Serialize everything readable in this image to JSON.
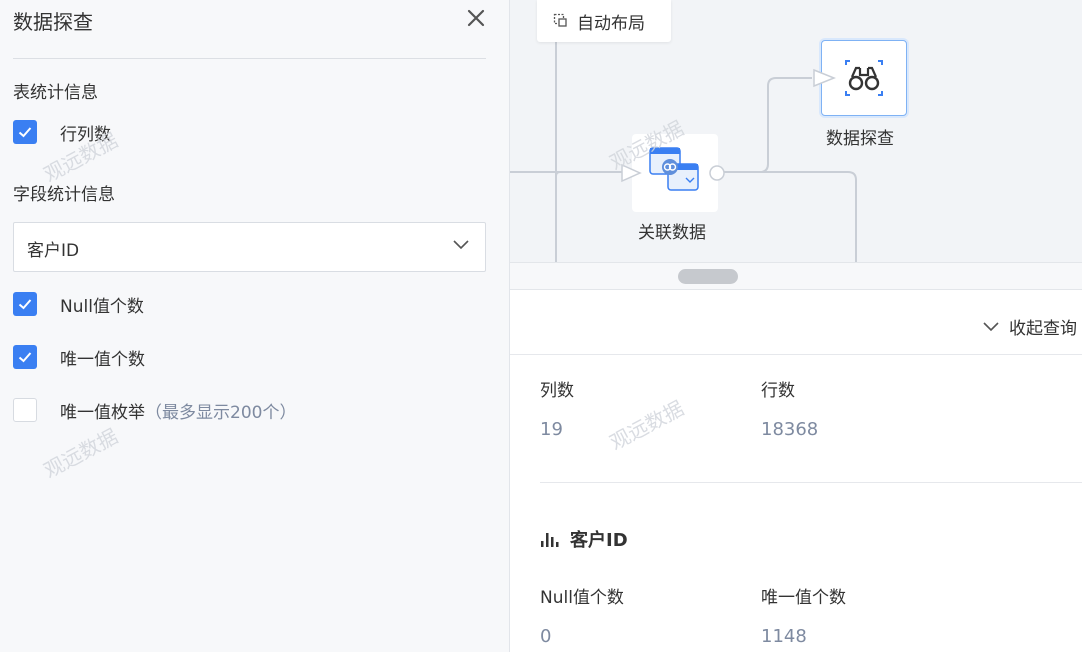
{
  "panel": {
    "title": "数据探查",
    "table_stats_label": "表统计信息",
    "row_col_label": "行列数",
    "field_stats_label": "字段统计信息",
    "field_select_value": "客户ID",
    "null_count_label": "Null值个数",
    "unique_count_label": "唯一值个数",
    "unique_enum_label": "唯一值枚举",
    "unique_enum_hint": "（最多显示200个）",
    "checkboxes": {
      "row_col": true,
      "null_count": true,
      "unique_count": true,
      "unique_enum": false
    }
  },
  "watermark": "观远数据",
  "canvas": {
    "auto_layout_label": "自动布局",
    "join_node_label": "关联数据",
    "explore_node_label": "数据探查"
  },
  "result": {
    "collapse_label": "收起查询",
    "col_count_label": "列数",
    "col_count_value": "19",
    "row_count_label": "行数",
    "row_count_value": "18368",
    "field_name": "客户ID",
    "null_count_label": "Null值个数",
    "null_count_value": "0",
    "unique_count_label": "唯一值个数",
    "unique_count_value": "1148"
  },
  "colors": {
    "accent": "#3a7ff2",
    "muted": "#7e8aa0"
  }
}
